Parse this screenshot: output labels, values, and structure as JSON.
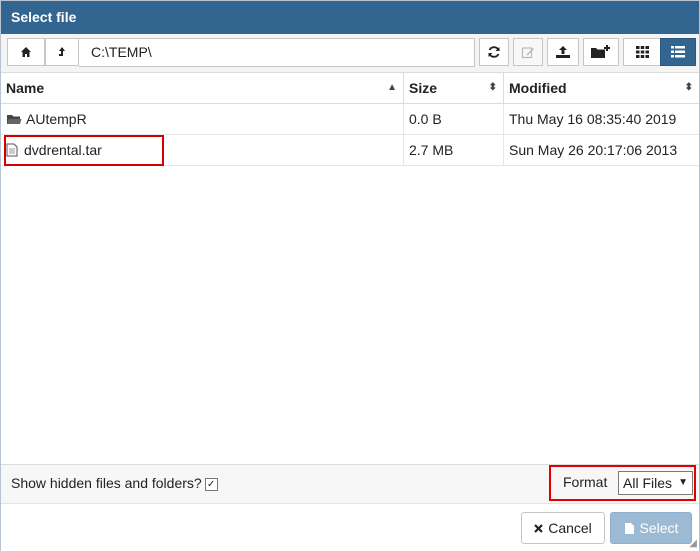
{
  "dialog": {
    "title": "Select file"
  },
  "toolbar": {
    "path": "C:\\TEMP\\",
    "home_icon": "home-icon",
    "up_icon": "up-arrow-icon",
    "refresh_icon": "refresh-icon",
    "rename_icon": "edit-icon",
    "upload_icon": "upload-icon",
    "new_folder_icon": "new-folder-icon",
    "grid_view_icon": "grid-view-icon",
    "list_view_icon": "list-view-icon"
  },
  "columns": {
    "name": "Name",
    "size": "Size",
    "modified": "Modified"
  },
  "rows": [
    {
      "icon": "folder-icon",
      "name": "AUtempR",
      "size": "0.0 B",
      "modified": "Thu May 16 08:35:40 2019"
    },
    {
      "icon": "file-icon",
      "name": "dvdrental.tar",
      "size": "2.7 MB",
      "modified": "Sun May 26 20:17:06 2013"
    }
  ],
  "footer": {
    "show_hidden_label": "Show hidden files and folders?",
    "show_hidden_checked": "✓",
    "format_label": "Format",
    "format_value": "All Files"
  },
  "buttons": {
    "cancel": "Cancel",
    "select": "Select"
  },
  "colors": {
    "titlebar": "#326690",
    "highlight": "#d40000",
    "select_button": "#9dbad5"
  }
}
